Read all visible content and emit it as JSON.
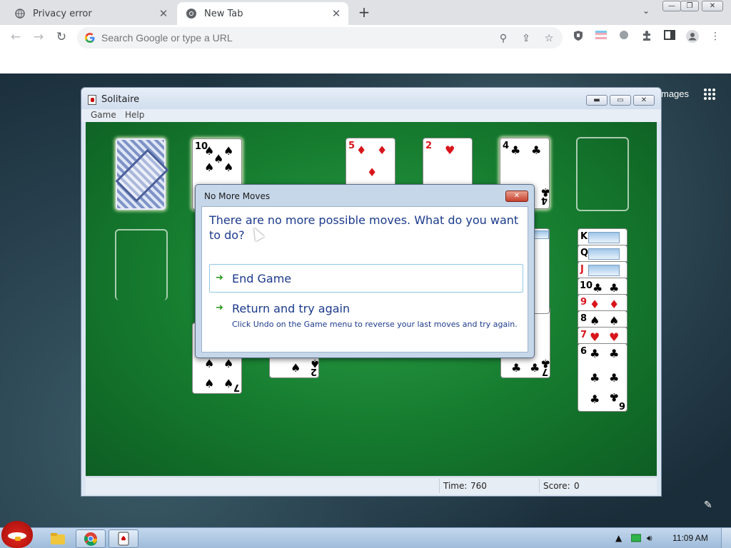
{
  "browser": {
    "tabs": [
      {
        "title": "Privacy error",
        "close": "✕"
      },
      {
        "title": "New Tab",
        "close": "✕"
      }
    ],
    "new_tab_symbol": "+",
    "tab_menu_symbol": "⌄",
    "window_controls": {
      "minimize": "—",
      "restore": "❐",
      "close": "✕"
    },
    "nav": {
      "back": "←",
      "forward": "→",
      "reload": "↻"
    },
    "omnibox_placeholder": "Search Google or type a URL",
    "omnibox_icons": {
      "zoom": "⚲",
      "share": "⇪",
      "bookmark": "☆"
    },
    "menu_symbol": "⋮"
  },
  "new_tab_page": {
    "images_link": "mages"
  },
  "solitaire": {
    "title": "Solitaire",
    "menus": [
      "Game",
      "Help"
    ],
    "window_controls": {
      "minimize": "▬",
      "maximize": "▭",
      "close": "✕"
    },
    "status": {
      "time_label": "Time:",
      "time_value": "760",
      "score_label": "Score:",
      "score_value": "0"
    },
    "waste": {
      "rank": "10",
      "suit": "♠"
    },
    "foundations": [
      {
        "rank": "5",
        "suit": "♦",
        "color": "red"
      },
      {
        "rank": "2",
        "suit": "♥",
        "color": "red"
      },
      {
        "rank": "4",
        "suit": "♣",
        "color": "black"
      }
    ],
    "tableau_partial": [
      {
        "rank": "7",
        "suit": "♠"
      },
      {
        "rank": "2",
        "suit": "♠"
      },
      {
        "rank": "7",
        "suit": "♣"
      }
    ],
    "tableau_right": [
      {
        "rank": "K",
        "suit": "",
        "color": "black"
      },
      {
        "rank": "Q",
        "suit": "",
        "color": "black"
      },
      {
        "rank": "J",
        "suit": "",
        "color": "red"
      },
      {
        "rank": "10",
        "suit": "♣",
        "color": "black"
      },
      {
        "rank": "9",
        "suit": "♦",
        "color": "red"
      },
      {
        "rank": "8",
        "suit": "♠",
        "color": "black"
      },
      {
        "rank": "7",
        "suit": "♥",
        "color": "red"
      },
      {
        "rank": "6",
        "suit": "♣",
        "color": "black"
      }
    ]
  },
  "dialog": {
    "title": "No More Moves",
    "close": "✕",
    "message": "There are no more possible moves. What do you want to do?",
    "options": [
      {
        "label": "End Game",
        "note": ""
      },
      {
        "label": "Return and try again",
        "note": "Click Undo on the Game menu to reverse your last moves and try again."
      }
    ]
  },
  "taskbar": {
    "clock": "11:09 AM"
  },
  "colors": {
    "felt": "#157a2e",
    "dialog_text": "#1c3a8c",
    "arrow": "#2f9a25"
  }
}
